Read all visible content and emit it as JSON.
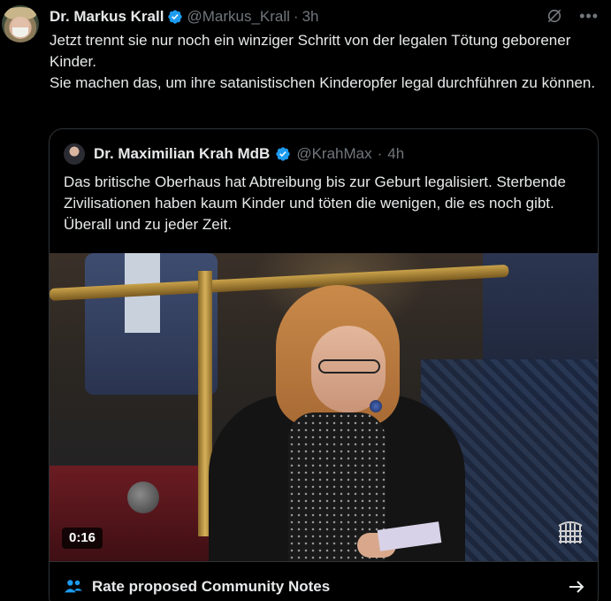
{
  "author": {
    "name": "Dr. Markus Krall",
    "handle": "@Markus_Krall",
    "separator": "·",
    "time": "3h"
  },
  "tweet_lines": [
    "Jetzt trennt sie nur noch ein winziger Schritt von der legalen Tötung geborener Kinder.",
    "Sie machen das, um ihre satanistischen Kinderopfer legal durchführen zu können."
  ],
  "quoted": {
    "name": "Dr. Maximilian Krah MdB",
    "handle": "@KrahMax",
    "separator": "·",
    "time": "4h",
    "text": "Das britische Oberhaus hat Abtreibung bis zur Geburt legalisiert. Sterbende Zivilisationen haben kaum Kinder und töten die wenigen, die es noch gibt. Überall und zu jeder Zeit.",
    "video_duration": "0:16"
  },
  "community_notes": {
    "label": "Rate proposed Community Notes"
  },
  "icons": {
    "verified": "verified-badge-icon",
    "grok": "grok-icon",
    "more": "more-icon",
    "people": "people-icon",
    "arrow": "arrow-right-icon",
    "portcullis": "portcullis-icon"
  },
  "colors": {
    "background": "#000000",
    "text": "#e7e9ea",
    "muted": "#71767b",
    "verified": "#1d9bf0",
    "border": "#2f3336"
  }
}
